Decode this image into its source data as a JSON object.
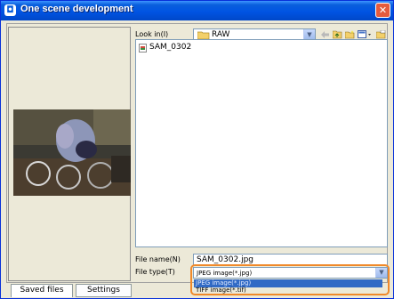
{
  "window": {
    "title": "One scene development",
    "close_symbol": "✕"
  },
  "browser": {
    "look_in_label": "Look in(I)",
    "look_in_value": "RAW",
    "files": [
      {
        "name": "SAM_0302"
      }
    ]
  },
  "fields": {
    "file_name_label": "File name(N)",
    "file_name_value": "SAM_0302.jpg",
    "file_type_label": "File type(T)",
    "file_type_value": "JPEG image(*.jpg)",
    "file_type_options": [
      "JPEG image(*.jpg)",
      "TIFF image(*.tif)"
    ],
    "file_type_selected_index": 0
  },
  "tabs": [
    {
      "label": "Saved files",
      "active": true
    },
    {
      "label": "Settings",
      "active": false
    }
  ],
  "icons": {
    "title": "app-icon",
    "folder": "folder-icon",
    "back": "back-arrow-icon",
    "up": "up-folder-icon",
    "new_folder": "new-folder-icon",
    "view": "view-menu-icon",
    "desktop": "desktop-icon",
    "file": "image-file-icon"
  },
  "colors": {
    "titlebar": "#0054e3",
    "highlight": "#f0892a",
    "selection": "#316ac5"
  }
}
